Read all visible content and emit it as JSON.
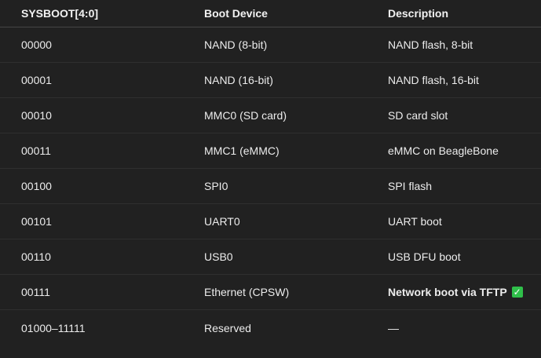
{
  "table": {
    "headers": [
      "SYSBOOT[4:0]",
      "Boot Device",
      "Description"
    ],
    "rows": [
      {
        "code": "00000",
        "device": "NAND (8-bit)",
        "description": "NAND flash, 8-bit"
      },
      {
        "code": "00001",
        "device": "NAND (16-bit)",
        "description": "NAND flash, 16-bit"
      },
      {
        "code": "00010",
        "device": "MMC0 (SD card)",
        "description": "SD card slot"
      },
      {
        "code": "00011",
        "device": "MMC1 (eMMC)",
        "description": "eMMC on BeagleBone"
      },
      {
        "code": "00100",
        "device": "SPI0",
        "description": "SPI flash"
      },
      {
        "code": "00101",
        "device": "UART0",
        "description": "UART boot"
      },
      {
        "code": "00110",
        "device": "USB0",
        "description": "USB DFU boot"
      },
      {
        "code": "00111",
        "device": "Ethernet (CPSW)",
        "description": "Network boot via TFTP",
        "check": "✓"
      },
      {
        "code": "01000–11111",
        "device": "Reserved",
        "description": "—"
      }
    ]
  },
  "icons": {
    "check": "check-mark-icon",
    "check_color": "#2fbf4a"
  }
}
